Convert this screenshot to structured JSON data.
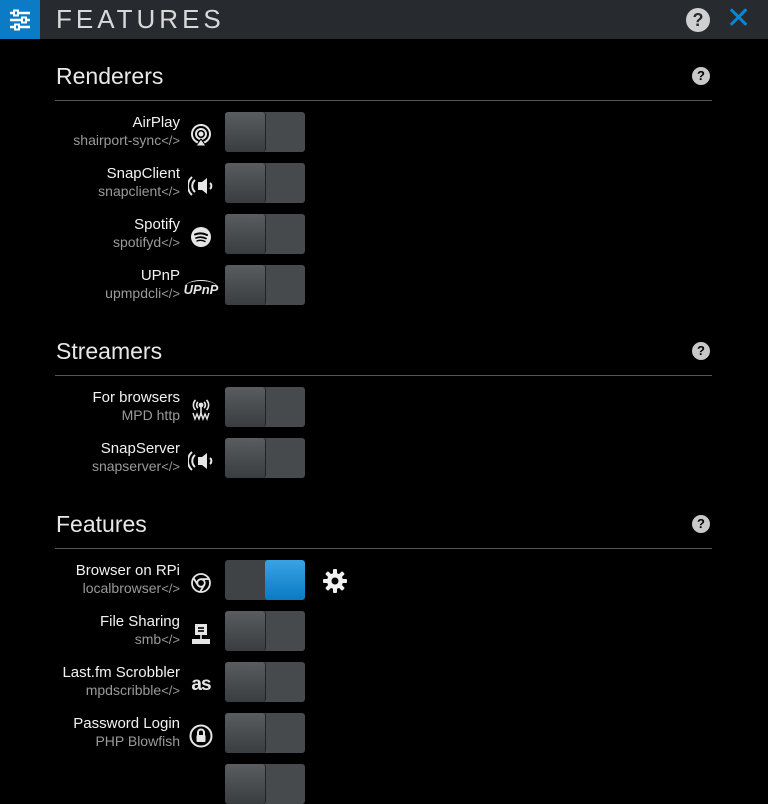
{
  "header": {
    "title": "FEATURES",
    "help_label": "?",
    "close_label": "✕"
  },
  "sections": [
    {
      "title": "Renderers",
      "help_label": "?",
      "items": [
        {
          "name": "AirPlay",
          "sub": "shairport-sync",
          "icon": "airplay-icon",
          "on": false
        },
        {
          "name": "SnapClient",
          "sub": "snapclient",
          "icon": "snapcast-icon",
          "on": false
        },
        {
          "name": "Spotify",
          "sub": "spotifyd",
          "icon": "spotify-icon",
          "on": false
        },
        {
          "name": "UPnP",
          "sub": "upmpdcli",
          "icon": "upnp-icon",
          "icon_text": "UPnP",
          "on": false
        }
      ]
    },
    {
      "title": "Streamers",
      "help_label": "?",
      "items": [
        {
          "name": "For browsers",
          "sub": "MPD http",
          "icon": "mpd-http-icon",
          "on": false
        },
        {
          "name": "SnapServer",
          "sub": "snapserver",
          "icon": "snapcast-icon",
          "on": false
        }
      ]
    },
    {
      "title": "Features",
      "help_label": "?",
      "items": [
        {
          "name": "Browser on RPi",
          "sub": "localbrowser",
          "icon": "chromium-icon",
          "on": true
        },
        {
          "name": "File Sharing",
          "sub": "smb",
          "icon": "file-sharing-icon",
          "on": false
        },
        {
          "name": "Last.fm Scrobbler",
          "sub": "mpdscribble",
          "icon": "lastfm-icon",
          "icon_text": "as",
          "on": false
        },
        {
          "name": "Password Login",
          "sub": "PHP Blowfish",
          "icon": "lock-icon",
          "on": false
        }
      ]
    }
  ],
  "code_glyph": "</>",
  "colors": {
    "accent": "#0a7bc4",
    "header_bg": "#272b2f",
    "switch_off": "#464a4d"
  }
}
